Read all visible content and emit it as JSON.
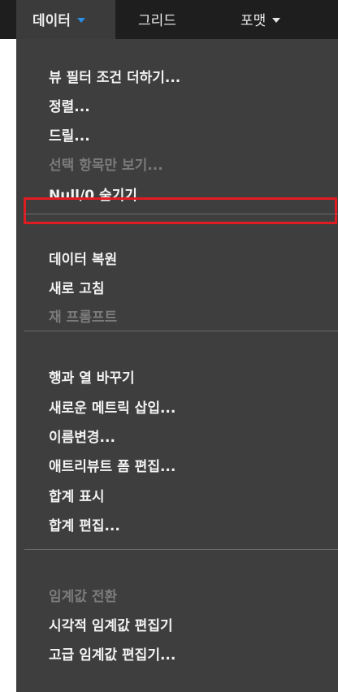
{
  "menubar": {
    "tabs": [
      {
        "label": "데이터"
      },
      {
        "label": "그리드"
      },
      {
        "label": "포맷"
      }
    ]
  },
  "menu": {
    "group1": [
      {
        "label": "뷰 필터 조건 더하기...",
        "enabled": true
      },
      {
        "label": "정렬...",
        "enabled": true
      },
      {
        "label": "드릴...",
        "enabled": true
      },
      {
        "label": "선택 항목만 보기...",
        "enabled": false
      },
      {
        "label": "Null/0 숨기기",
        "enabled": true,
        "highlighted": true
      }
    ],
    "group2": [
      {
        "label": "데이터 복원",
        "enabled": true
      },
      {
        "label": "새로 고침",
        "enabled": true
      },
      {
        "label": "재 프롬프트",
        "enabled": false
      }
    ],
    "group3": [
      {
        "label": "행과 열 바꾸기",
        "enabled": true
      },
      {
        "label": "새로운 메트릭 삽입...",
        "enabled": true
      },
      {
        "label": "이름변경...",
        "enabled": true
      },
      {
        "label": "애트리뷰트 폼 편집...",
        "enabled": true
      },
      {
        "label": "합계 표시",
        "enabled": true
      },
      {
        "label": "합계 편집...",
        "enabled": true
      }
    ],
    "group4": [
      {
        "label": "임계값 전환",
        "enabled": false
      },
      {
        "label": "시각적 임계값 편집기",
        "enabled": true
      },
      {
        "label": "고급 임계값 편집기...",
        "enabled": true
      }
    ]
  },
  "colors": {
    "menubar_bg": "#1e1e1e",
    "active_tab_bg": "#3b3b3b",
    "dropdown_bg": "#3e3e3e",
    "text": "#f2f2f2",
    "disabled_text": "#7b7b7b",
    "highlight_border": "#e11b22",
    "caret_active": "#2a8fe6"
  }
}
